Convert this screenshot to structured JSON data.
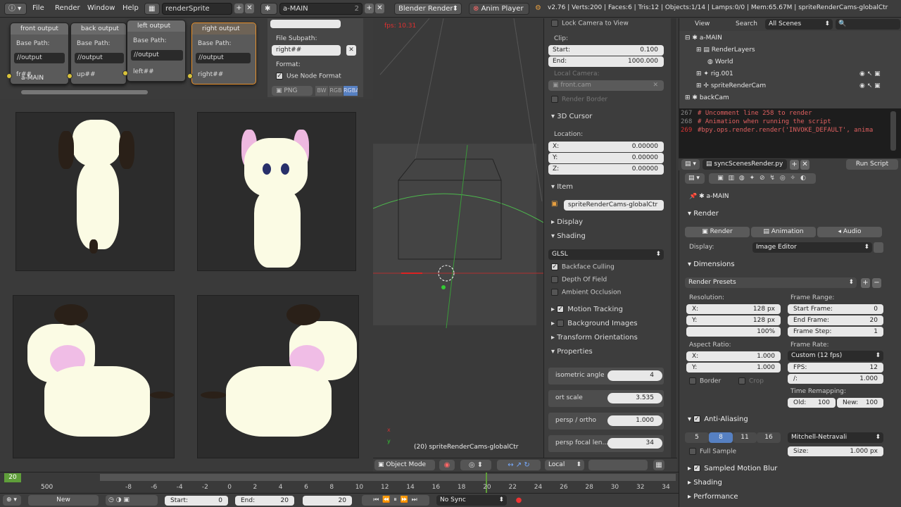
{
  "topbar": {
    "menus": [
      "File",
      "Render",
      "Window",
      "Help"
    ],
    "screen_name": "renderSprite",
    "scene_name": "a-MAIN",
    "scene_users": "2",
    "engine": "Blender Render",
    "anim_player": "Anim Player",
    "stats": "v2.76 | Verts:200 | Faces:6 | Tris:12 | Objects:1/14 | Lamps:0/0 | Mem:65.67M | spriteRenderCams-globalCtr"
  },
  "node_editor": {
    "nodes": [
      {
        "title": "front output",
        "base_path_label": "Base Path:",
        "base_path": "//output",
        "output": "fr##"
      },
      {
        "title": "back output",
        "base_path_label": "Base Path:",
        "base_path": "//output",
        "output": "up##"
      },
      {
        "title": "left output",
        "base_path_label": "Base Path:",
        "base_path": "//output",
        "output": "left##"
      },
      {
        "title": "right output",
        "base_path_label": "Base Path:",
        "base_path": "//output",
        "output": "right##"
      }
    ],
    "scene_label": "a-MAIN",
    "side_panel": {
      "file_subpath_label": "File Subpath:",
      "file_subpath": "right##",
      "format_label": "Format:",
      "use_node_format": "Use Node Format",
      "format_value": "PNG",
      "color_modes": [
        "BW",
        "RGB",
        "RGBA"
      ]
    }
  },
  "view3d": {
    "fps": "fps: 10.31",
    "object_label": "(20) spriteRenderCams-globalCtr",
    "mode": "Object Mode",
    "orientation": "Local",
    "axis_x": "x",
    "axis_y": "y"
  },
  "props3d": {
    "lock_camera": "Lock Camera to View",
    "clip_label": "Clip:",
    "clip_start_label": "Start:",
    "clip_start": "0.100",
    "clip_end_label": "End:",
    "clip_end": "1000.000",
    "local_camera_label": "Local Camera:",
    "local_camera": "front.cam",
    "render_border": "Render Border",
    "cursor_title": "3D Cursor",
    "location_label": "Location:",
    "cursor_x_label": "X:",
    "cursor_x": "0.00000",
    "cursor_y_label": "Y:",
    "cursor_y": "0.00000",
    "cursor_z_label": "Z:",
    "cursor_z": "0.00000",
    "item_title": "Item",
    "item_name": "spriteRenderCams-globalCtr",
    "display_title": "Display",
    "shading_title": "Shading",
    "shading_mode": "GLSL",
    "backface_culling": "Backface Culling",
    "depth_of_field": "Depth Of Field",
    "ambient_occlusion": "Ambient Occlusion",
    "motion_tracking": "Motion Tracking",
    "background_images": "Background Images",
    "transform_orientations": "Transform Orientations",
    "properties_title": "Properties",
    "custom_props": [
      {
        "label": "isometric angle",
        "value": "4"
      },
      {
        "label": "ort scale",
        "value": "3.535"
      },
      {
        "label": "persp / ortho",
        "value": "1.000"
      },
      {
        "label": "persp focal len...",
        "value": "34"
      }
    ]
  },
  "outliner": {
    "menus": [
      "View",
      "Search"
    ],
    "filter": "All Scenes",
    "rows": [
      "a-MAIN",
      "RenderLayers",
      "World",
      "rig.001",
      "spriteRenderCam",
      "backCam"
    ]
  },
  "text_editor": {
    "line_numbers": [
      "267",
      "268",
      "269"
    ],
    "lines": [
      "# Uncomment line 258 to render",
      "# Animation when running the script",
      "#bpy.ops.render.render('INVOKE_DEFAULT', anima"
    ],
    "file_name": "syncScenesRender.py",
    "run_script": "Run Script"
  },
  "render_props": {
    "scene_name": "a-MAIN",
    "render_title": "Render",
    "render_button": "Render",
    "animation_button": "Animation",
    "audio_button": "Audio",
    "display_label": "Display:",
    "display_value": "Image Editor",
    "dimensions_title": "Dimensions",
    "render_presets": "Render Presets",
    "resolution_label": "Resolution:",
    "res_x_label": "X:",
    "res_x": "128 px",
    "res_y_label": "Y:",
    "res_y": "128 px",
    "res_pct": "100%",
    "frame_range_label": "Frame Range:",
    "start_frame_label": "Start Frame:",
    "start_frame": "0",
    "end_frame_label": "End Frame:",
    "end_frame": "20",
    "frame_step_label": "Frame Step:",
    "frame_step": "1",
    "aspect_label": "Aspect Ratio:",
    "aspect_x_label": "X:",
    "aspect_x": "1.000",
    "aspect_y_label": "Y:",
    "aspect_y": "1.000",
    "border_label": "Border",
    "crop_label": "Crop",
    "frame_rate_label": "Frame Rate:",
    "frame_rate": "Custom (12 fps)",
    "fps_label": "FPS:",
    "fps": "12",
    "fps_base_label": "/:",
    "fps_base": "1.000",
    "time_remap_label": "Time Remapping:",
    "old_label": "Old:",
    "old_value": "100",
    "new_label": "New:",
    "new_value": "100",
    "aa_title": "Anti-Aliasing",
    "aa_samples": [
      "5",
      "8",
      "11",
      "16"
    ],
    "aa_filter": "Mitchell-Netravali",
    "full_sample": "Full Sample",
    "size_label": "Size:",
    "size_value": "1.000 px",
    "motion_blur": "Sampled Motion Blur",
    "shading_title": "Shading",
    "performance_title": "Performance"
  },
  "timeline": {
    "current_frame": "20",
    "left_value": "500",
    "ticks": [
      "-8",
      "-6",
      "-4",
      "-2",
      "0",
      "2",
      "4",
      "6",
      "8",
      "10",
      "12",
      "14",
      "16",
      "18",
      "20",
      "22",
      "24",
      "26",
      "28",
      "30",
      "32",
      "34"
    ]
  },
  "bottombar": {
    "new_label": "New",
    "start_label": "Start:",
    "start_value": "0",
    "end_label": "End:",
    "end_value": "20",
    "current": "20",
    "sync": "No Sync"
  },
  "colors": {
    "accent_blue": "#5680c2",
    "fps_red": "#e03030",
    "sprite_white": "#fbfbe4",
    "keyframe_green": "#9fd264"
  }
}
